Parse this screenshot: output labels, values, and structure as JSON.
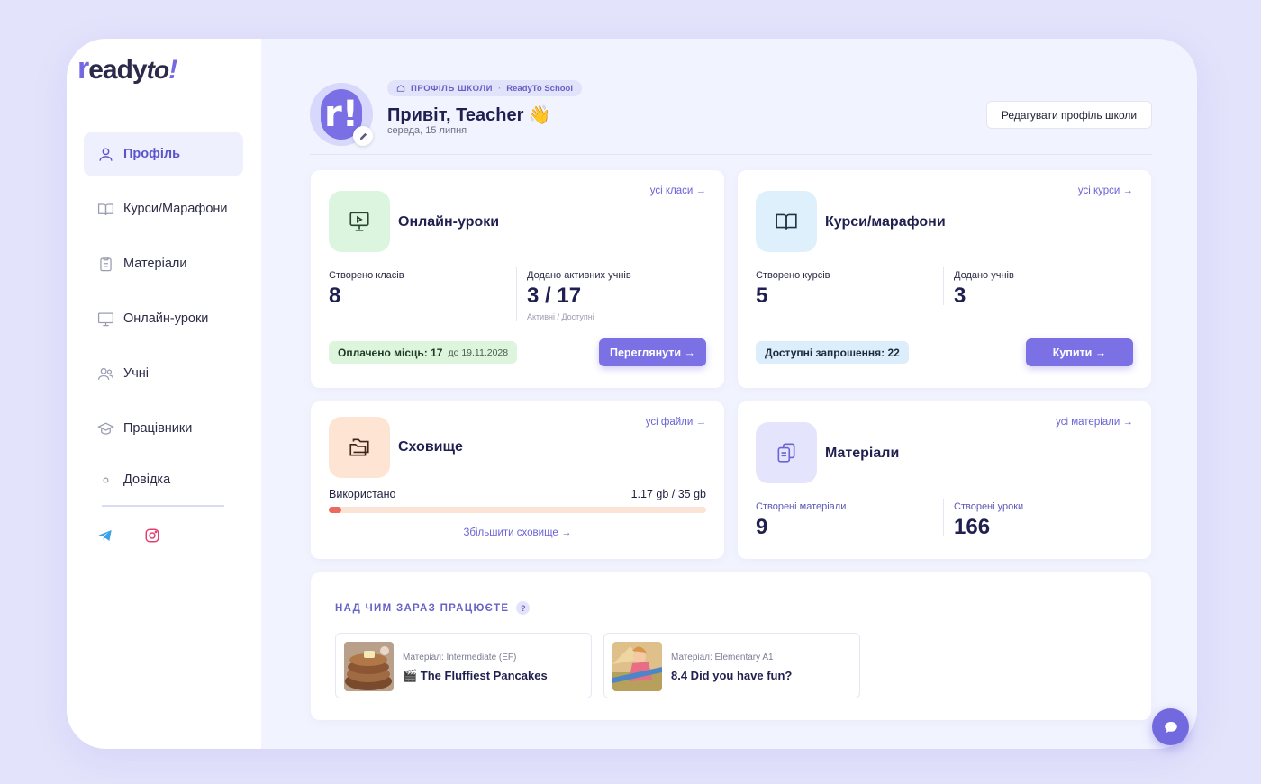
{
  "logo": {
    "part1": "r",
    "part2": "eady",
    "part3": "to",
    "part4": "!"
  },
  "sidebar": {
    "items": [
      {
        "label": "Профіль",
        "icon": "user-icon"
      },
      {
        "label": "Курси/Марафони",
        "icon": "book-open-icon"
      },
      {
        "label": "Матеріали",
        "icon": "clipboard-icon"
      },
      {
        "label": "Онлайн-уроки",
        "icon": "monitor-icon"
      },
      {
        "label": "Учні",
        "icon": "users-icon"
      },
      {
        "label": "Працівники",
        "icon": "graduation-cap-icon"
      },
      {
        "label": "Довідка",
        "icon": "dot-icon"
      }
    ],
    "social": [
      "telegram-icon",
      "instagram-icon"
    ]
  },
  "header": {
    "badge_caption": "ПРОФІЛЬ ШКОЛИ",
    "badge_separator": "·",
    "school_name": "ReadyTo School",
    "greeting": "Привіт, Teacher 👋",
    "date": "середа, 15 липня",
    "edit_button": "Редагувати профіль школи",
    "avatar_letter": "r!"
  },
  "online_lessons": {
    "title": "Онлайн-уроки",
    "link": "усі класи →",
    "stat1_label": "Створено класів",
    "stat1_value": "8",
    "stat2_label": "Додано активних учнів",
    "stat2_value": "3 / 17",
    "stat2_sub": "Активні / Доступні",
    "paid_label": "Оплачено місць: 17",
    "paid_until": "до 19.11.2028",
    "button": "Переглянути →",
    "icon": "presentation-icon"
  },
  "courses": {
    "title": "Курси/марафони",
    "link": "усі курси →",
    "stat1_label": "Створено курсів",
    "stat1_value": "5",
    "stat2_label": "Додано учнів",
    "stat2_value": "3",
    "invites": "Доступні запрошення: 22",
    "button": "Купити →",
    "icon": "book-open-icon"
  },
  "storage": {
    "title": "Сховище",
    "link": "усі файли →",
    "used_label": "Використано",
    "used_value": "1.17 gb / 35 gb",
    "used_fraction": 0.033,
    "increase_link": "Збільшити сховище →",
    "icon": "folders-icon"
  },
  "materials": {
    "title": "Матеріали",
    "link": "усі матеріали →",
    "stat1_label": "Створені матеріали",
    "stat1_value": "9",
    "stat2_label": "Створені уроки",
    "stat2_value": "166",
    "icon": "copy-icon"
  },
  "wip": {
    "title": "НАД ЧИМ ЗАРАЗ ПРАЦЮЄТЕ",
    "help": "?",
    "items": [
      {
        "sub": "Матеріал: Intermediate (EF)",
        "name": "🎬 The Fluffiest Pancakes"
      },
      {
        "sub": "Матеріал: Elementary A1",
        "name": "8.4 Did you have fun?"
      }
    ]
  },
  "colors": {
    "accent": "#7b71e4",
    "online_icon_bg": "#dcf5df",
    "courses_icon_bg": "#dff0fd",
    "storage_icon_bg": "#fde4d3",
    "materials_icon_bg": "#e4e5fc",
    "paid_pill_bg": "#dcf5dc",
    "invite_pill_bg": "#dcedfb",
    "storage_fill": "#ea6a5e"
  }
}
